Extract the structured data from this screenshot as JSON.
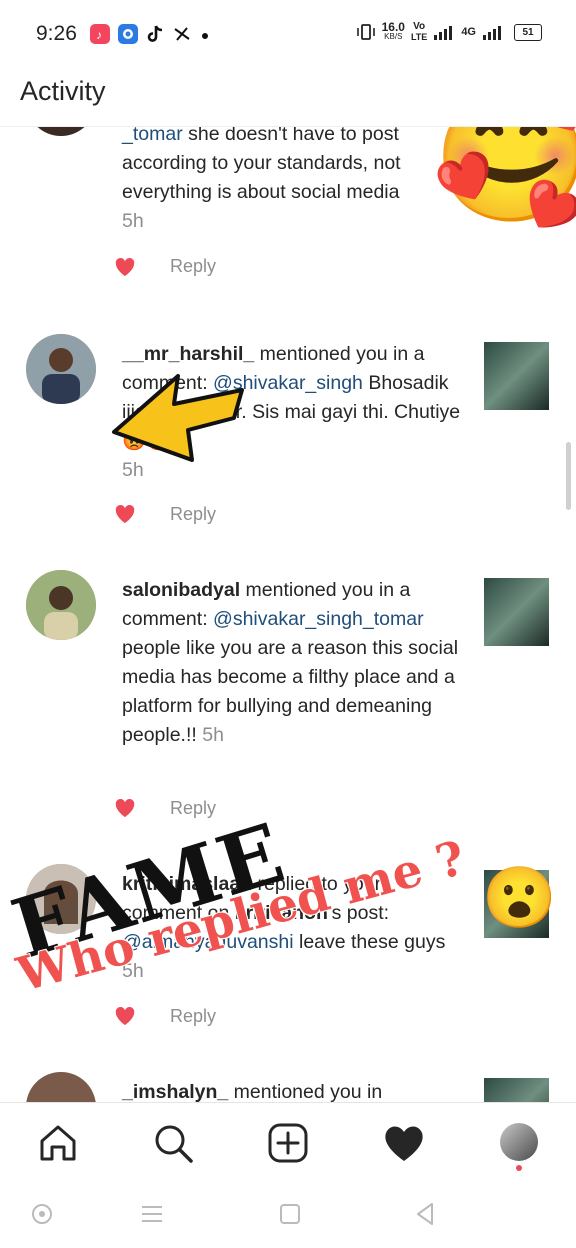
{
  "status_bar": {
    "time": "9:26",
    "net_speed": "16.0",
    "net_unit": "KB/S",
    "volte_top": "Vo",
    "volte_bottom": "LTE",
    "network": "4G",
    "battery": "51"
  },
  "header": {
    "title": "Activity"
  },
  "items": [
    {
      "text_partial_top": "_tomar",
      "text_rest": " she doesn't have to post according to your standards, not everything is about social media",
      "time": "5h",
      "reply_label": "Reply"
    },
    {
      "username": "__mr_harshil_",
      "action": " mentioned you in a comment: ",
      "mention": "@shivakar_singh",
      "body": " Bhosadik ijjat se bat kar. Sis mai gayi thi.  Chutiye",
      "emoji": "😡😡",
      "time": "5h",
      "reply_label": "Reply"
    },
    {
      "username": "salonibadyal",
      "action": " mentioned you in a comment: ",
      "mention": "@shivakar_singh_tomar",
      "body": " people like you are a reason this social media has become a filthy place and a platform for bullying and demeaning people.!!",
      "time": "5h",
      "reply_label": "Reply"
    },
    {
      "username": "kritikimaslaan",
      "action": " replied to your comment on ",
      "post_owner": "kritisanon",
      "action2": "'s post: ",
      "mention": "@aimanyaduvanshi",
      "body": " leave these guys",
      "time": "5h",
      "reply_label": "Reply"
    },
    {
      "username": "_imshalyn_",
      "action": " mentioned you in"
    }
  ],
  "overlay": {
    "fame": "FAME",
    "who_replied": "Who replied me ?",
    "emoji_love": "🥰",
    "emoji_surprised": "😮"
  },
  "colors": {
    "heart": "#ed4956",
    "mention": "#1f4e7a",
    "secondary_text": "#8e8e8e",
    "overlay_red": "#f0524f",
    "arrow_yellow": "#f7c21a"
  }
}
